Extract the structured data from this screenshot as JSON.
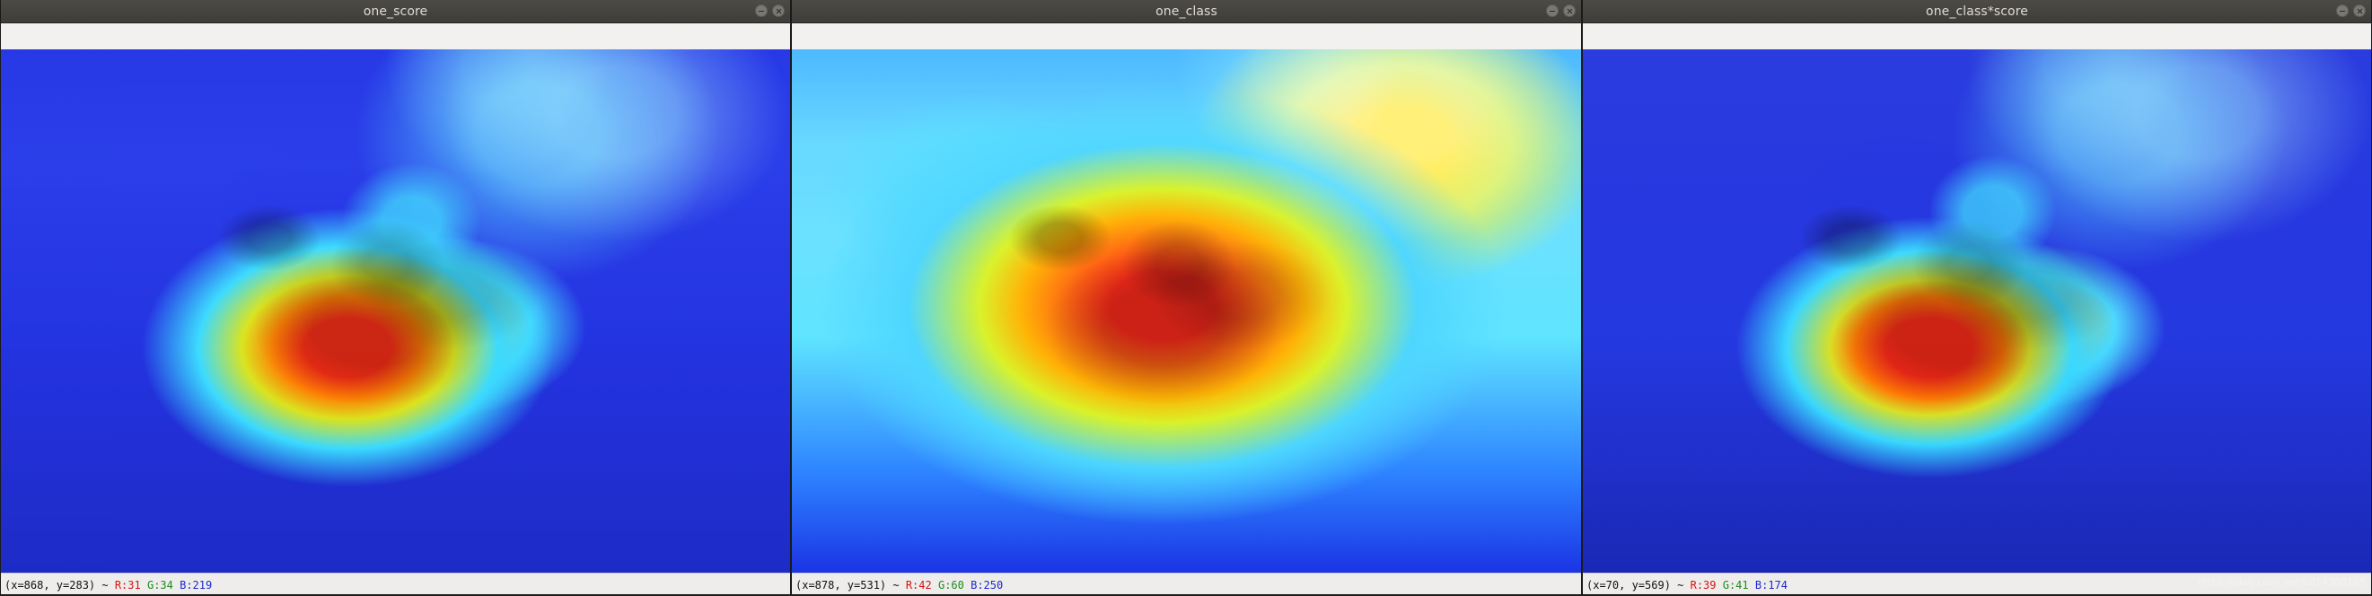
{
  "windows": [
    {
      "title": "one_score",
      "status": {
        "prefix": "(x=868, y=283) ~ ",
        "r": "R:31",
        "g": "G:34",
        "b": "B:219"
      },
      "controls": [
        {
          "name": "minimize-icon"
        },
        {
          "name": "close-icon"
        }
      ]
    },
    {
      "title": "one_class",
      "status": {
        "prefix": "(x=878, y=531) ~ ",
        "r": "R:42",
        "g": "G:60",
        "b": "B:250"
      },
      "controls": [
        {
          "name": "minimize-icon"
        },
        {
          "name": "close-icon"
        }
      ]
    },
    {
      "title": "one_class*score",
      "status": {
        "prefix": "(x=70, y=569) ~ ",
        "r": "R:39",
        "g": "G:41",
        "b": "B:174"
      },
      "controls": [
        {
          "name": "minimize-icon"
        },
        {
          "name": "close-icon"
        }
      ],
      "watermark": "https://blog.csdn.net/u014380165"
    }
  ]
}
